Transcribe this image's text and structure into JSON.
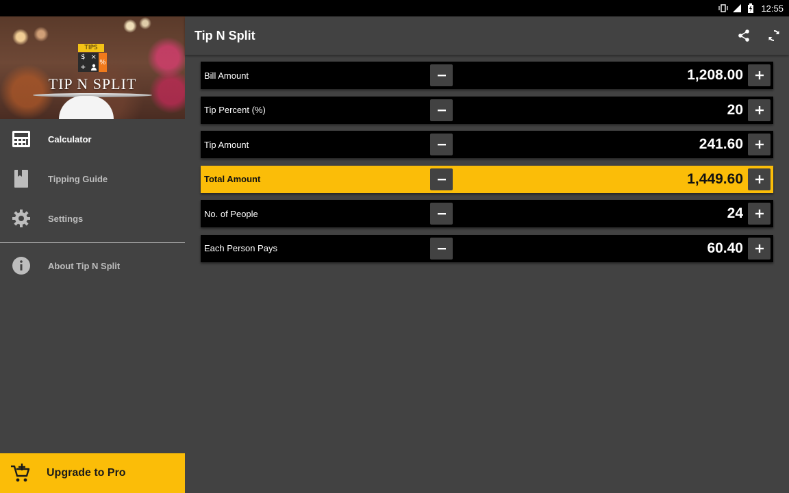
{
  "statusbar": {
    "time": "12:55",
    "icons": [
      "vibrate-icon",
      "signal-icon",
      "battery-icon"
    ]
  },
  "drawer": {
    "logo": {
      "tab": "TIPS",
      "grid": [
        "$",
        "×",
        "+",
        "person"
      ],
      "pct": "%",
      "brand": "TIP N SPLIT"
    },
    "items": [
      {
        "label": "Calculator",
        "icon": "calculator-icon",
        "active": true
      },
      {
        "label": "Tipping Guide",
        "icon": "book-icon",
        "active": false
      },
      {
        "label": "Settings",
        "icon": "gear-icon",
        "active": false
      },
      {
        "label": "About Tip N Split",
        "icon": "info-icon",
        "active": false
      }
    ],
    "upgrade_label": "Upgrade to Pro",
    "upgrade_icon": "cart-plus-icon"
  },
  "appbar": {
    "title": "Tip N Split",
    "actions": [
      "share-icon",
      "refresh-icon"
    ]
  },
  "rows": [
    {
      "label": "Bill Amount",
      "value": "1,208.00",
      "highlight": false
    },
    {
      "label": "Tip Percent (%)",
      "value": "20",
      "highlight": false
    },
    {
      "label": "Tip Amount",
      "value": "241.60",
      "highlight": false
    },
    {
      "label": "Total Amount",
      "value": "1,449.60",
      "highlight": true
    },
    {
      "label": "No. of People",
      "value": "24",
      "highlight": false
    },
    {
      "label": "Each Person Pays",
      "value": "60.40",
      "highlight": false
    }
  ],
  "colors": {
    "accent": "#fbbd08",
    "background": "#424242",
    "row": "#000000"
  }
}
